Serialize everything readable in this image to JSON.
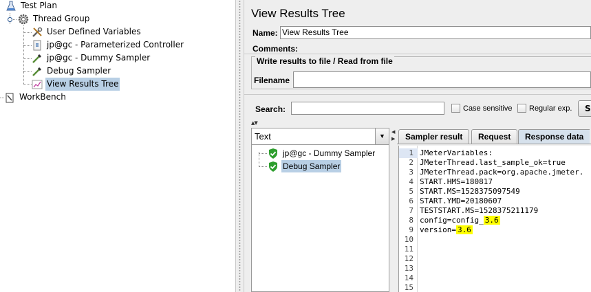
{
  "tree": {
    "items": [
      {
        "label": "Test Plan",
        "icon": "flask-icon"
      },
      {
        "label": "Thread Group",
        "icon": "gear-icon"
      },
      {
        "label": "User Defined Variables",
        "icon": "wrench-icon"
      },
      {
        "label": "jp@gc - Parameterized Controller",
        "icon": "controller-icon"
      },
      {
        "label": "jp@gc - Dummy Sampler",
        "icon": "pipette-icon"
      },
      {
        "label": "Debug Sampler",
        "icon": "pipette-icon"
      },
      {
        "label": "View Results Tree",
        "icon": "chart-icon",
        "selected": true
      },
      {
        "label": "WorkBench",
        "icon": "clipboard-icon"
      }
    ]
  },
  "panel": {
    "title": "View Results Tree",
    "name_label": "Name:",
    "name_value": "View Results Tree",
    "comments_label": "Comments:",
    "file_group_title": "Write results to file / Read from file",
    "filename_label": "Filename",
    "filename_value": "",
    "search_label": "Search:",
    "search_value": "",
    "case_sensitive_label": "Case sensitive",
    "regex_label": "Regular exp.",
    "search_button_label": "S"
  },
  "results": {
    "renderer": "Text",
    "items": [
      {
        "label": "jp@gc - Dummy Sampler",
        "status": "success"
      },
      {
        "label": "Debug Sampler",
        "status": "success",
        "selected": true
      }
    ]
  },
  "tabs": [
    {
      "label": "Sampler result",
      "active": false
    },
    {
      "label": "Request",
      "active": false
    },
    {
      "label": "Response data",
      "active": true
    }
  ],
  "response": {
    "lines": [
      {
        "n": "1",
        "text": "JMeterVariables:"
      },
      {
        "n": "2",
        "text": "JMeterThread.last_sample_ok=true"
      },
      {
        "n": "3",
        "text": "JMeterThread.pack=org.apache.jmeter."
      },
      {
        "n": "4",
        "text": "START.HMS=180817"
      },
      {
        "n": "5",
        "text": "START.MS=1528375097549"
      },
      {
        "n": "6",
        "text": "START.YMD=20180607"
      },
      {
        "n": "7",
        "text": "TESTSTART.MS=1528375211179"
      },
      {
        "n": "8",
        "text": "config=config_",
        "highlight": "3.6"
      },
      {
        "n": "9",
        "text": "version=",
        "highlight": "3.6"
      },
      {
        "n": "10",
        "text": ""
      },
      {
        "n": "11",
        "text": ""
      },
      {
        "n": "12",
        "text": ""
      },
      {
        "n": "13",
        "text": ""
      },
      {
        "n": "14",
        "text": ""
      },
      {
        "n": "15",
        "text": ""
      }
    ]
  },
  "colors": {
    "selection": "#b8cfe5",
    "highlight": "#ffff00",
    "success_shield": "#2e9e2e"
  }
}
